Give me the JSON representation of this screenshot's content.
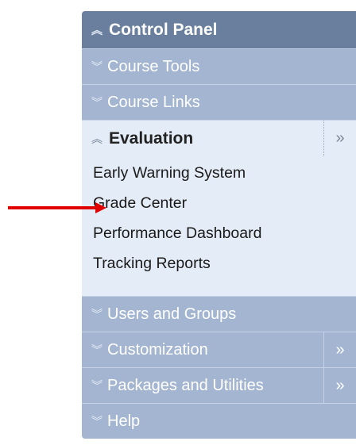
{
  "header": {
    "title": "Control Panel",
    "icon": "chevron-up-double-icon"
  },
  "sections": [
    {
      "label": "Course Tools"
    },
    {
      "label": "Course Links"
    }
  ],
  "evaluation": {
    "label": "Evaluation",
    "more": "»",
    "items": [
      "Early Warning System",
      "Grade Center",
      "Performance Dashboard",
      "Tracking Reports"
    ]
  },
  "lower_sections": [
    {
      "label": "Users and Groups"
    },
    {
      "label": "Customization",
      "more": "»"
    },
    {
      "label": "Packages and Utilities",
      "more": "»"
    },
    {
      "label": "Help"
    }
  ],
  "glyphs": {
    "collapse": "«",
    "expand": "»"
  },
  "colors": {
    "header_bg": "#6a7f9e",
    "row_bg": "#a3b5d1",
    "expanded_bg": "#e4ecf7",
    "arrow": "#e00000"
  },
  "annotation": {
    "points_to": "Grade Center"
  }
}
